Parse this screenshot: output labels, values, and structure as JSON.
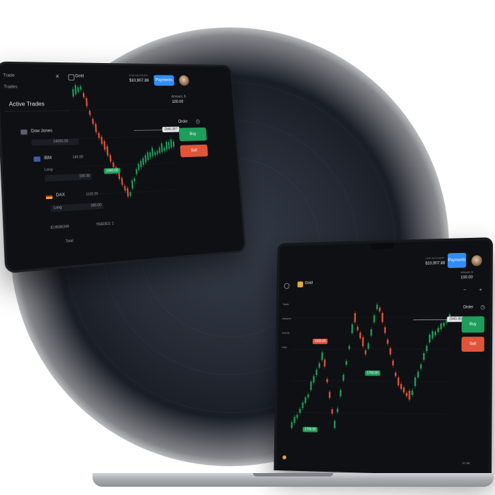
{
  "colors": {
    "buy": "#1f9d5a",
    "sell": "#e0553a",
    "deposit": "#2f8df5",
    "background": "#0e1013"
  },
  "tablet": {
    "nav_top_1": "Trade",
    "nav_top_2": "Trades",
    "panel_title": "Active Trades",
    "close_glyph": "×",
    "asset_label": "Gold",
    "account_label": "LIVE ACCOUNT",
    "balance": "$10,907.88",
    "deposit_label": "Payments",
    "amount_label": "Amount, $",
    "amount_value": "100.00",
    "order_label": "Order",
    "buy_label": "Buy",
    "sell_label": "Sell",
    "price_tag": "1940.35?",
    "chart_tag": "1940.00",
    "user_name": "Dow Jones",
    "user_value": "14000.00",
    "items": [
      {
        "name": "IBM",
        "label": "Long",
        "value": "140.00",
        "sub": "100.00"
      },
      {
        "name": "DAX",
        "label": "Long",
        "value": "1100.00",
        "sub": "180.00"
      }
    ],
    "footer_1": "ID:8586349",
    "footer_2": "TRADES: 1",
    "footer_3": "Total"
  },
  "laptop": {
    "asset_label": "Gold",
    "account_label": "LIVE ACCOUNT",
    "balance": "$10,907.88",
    "deposit_label": "Payments",
    "amount_label": "Amount, $",
    "amount_value": "100.00",
    "order_label": "Order",
    "buy_label": "Buy",
    "sell_label": "Sell",
    "price_tag": "1940.35?",
    "tag_red": "1905.00",
    "tag_green_mid": "1760.00",
    "tag_green_low": "1705.00",
    "side_items": [
      "Trade",
      "Markets",
      "Events",
      "Help"
    ],
    "footer_label": "1D 3M"
  }
}
